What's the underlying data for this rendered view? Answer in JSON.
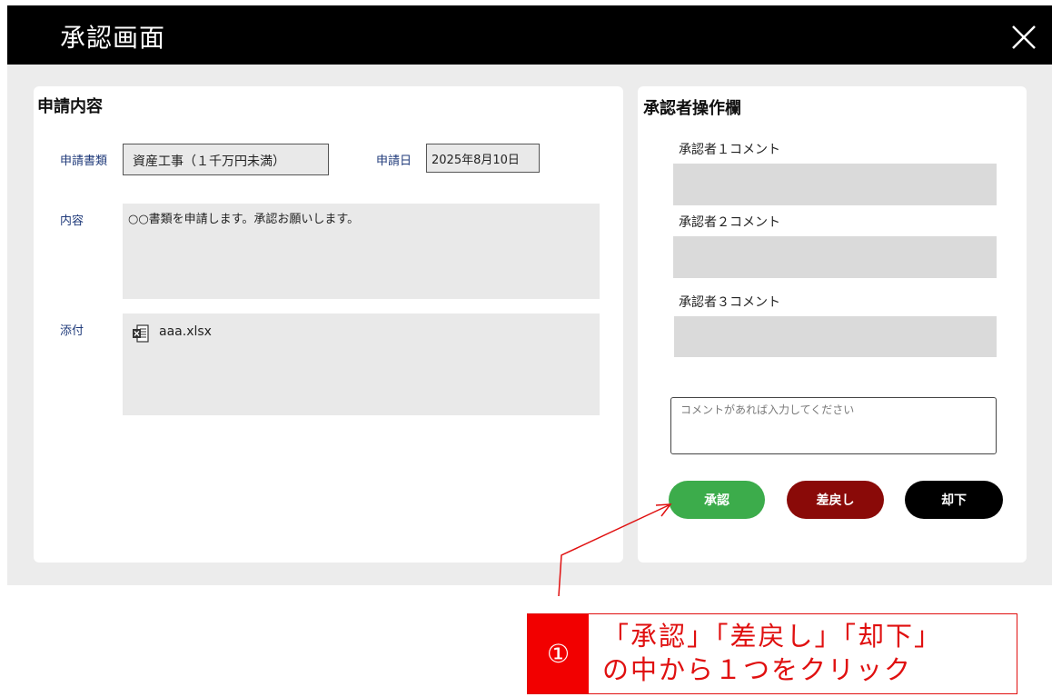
{
  "header": {
    "title": "承認画面"
  },
  "application": {
    "section_title": "申請内容",
    "doc_type_label": "申請書類",
    "doc_type_value": "資産工事（１千万円未満）",
    "date_label": "申請日",
    "date_value": "2025年8月10日",
    "content_label": "内容",
    "content_value": "○○書類を申請します。承認お願いします。",
    "attachment_label": "添付",
    "attachment_file": "aaa.xlsx",
    "attachment_icon": "excel-file-icon"
  },
  "approver": {
    "section_title": "承認者操作欄",
    "comments": [
      {
        "label": "承認者１コメント"
      },
      {
        "label": "承認者２コメント"
      },
      {
        "label": "承認者３コメント"
      }
    ],
    "input_placeholder": "コメントがあれば入力してください",
    "buttons": {
      "approve": "承認",
      "return": "差戻し",
      "reject": "却下"
    }
  },
  "annotation": {
    "number": "①",
    "line1": "「承認」「差戻し」「却下」",
    "line2": "の中から１つをクリック"
  },
  "colors": {
    "header_bg": "#000000",
    "approve": "#3cac4b",
    "return": "#8a0a08",
    "reject": "#000000",
    "annotation_red": "#e01010",
    "label_blue": "#1f3a7a"
  }
}
